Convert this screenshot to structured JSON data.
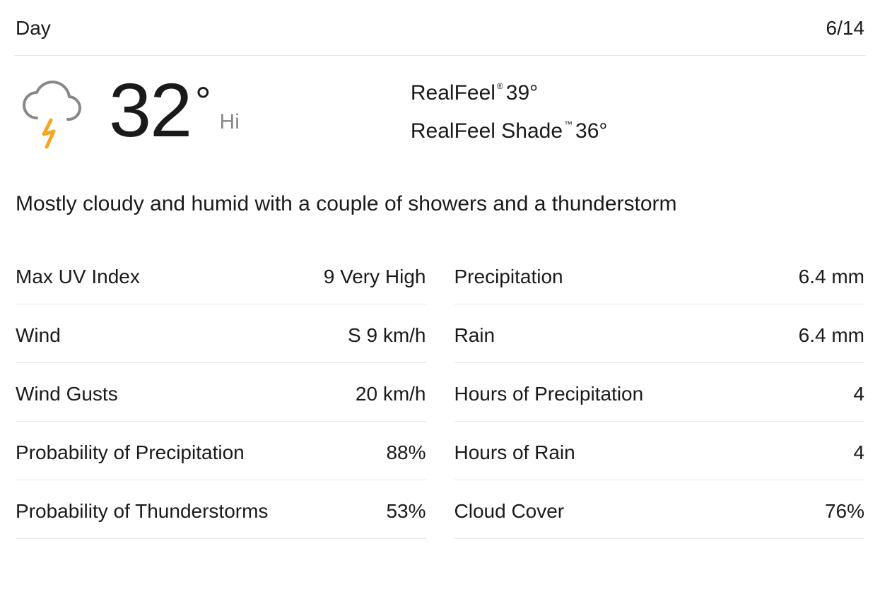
{
  "header": {
    "title": "Day",
    "date": "6/14"
  },
  "temp": {
    "value": "32",
    "degree": "°",
    "hi_label": "Hi"
  },
  "realfeel": {
    "label": "RealFeel",
    "symbol": "®",
    "value": " 39°"
  },
  "realfeel_shade": {
    "label": "RealFeel Shade",
    "symbol": "™",
    "value": " 36°"
  },
  "description": "Mostly cloudy and humid with a couple of showers and a thunderstorm",
  "left_col": [
    {
      "label": "Max UV Index",
      "value": "9 Very High"
    },
    {
      "label": "Wind",
      "value": "S 9 km/h"
    },
    {
      "label": "Wind Gusts",
      "value": "20 km/h"
    },
    {
      "label": "Probability of Precipitation",
      "value": "88%"
    },
    {
      "label": "Probability of Thunderstorms",
      "value": "53%"
    }
  ],
  "right_col": [
    {
      "label": "Precipitation",
      "value": "6.4 mm"
    },
    {
      "label": "Rain",
      "value": "6.4 mm"
    },
    {
      "label": "Hours of Precipitation",
      "value": "4"
    },
    {
      "label": "Hours of Rain",
      "value": "4"
    },
    {
      "label": "Cloud Cover",
      "value": "76%"
    }
  ]
}
